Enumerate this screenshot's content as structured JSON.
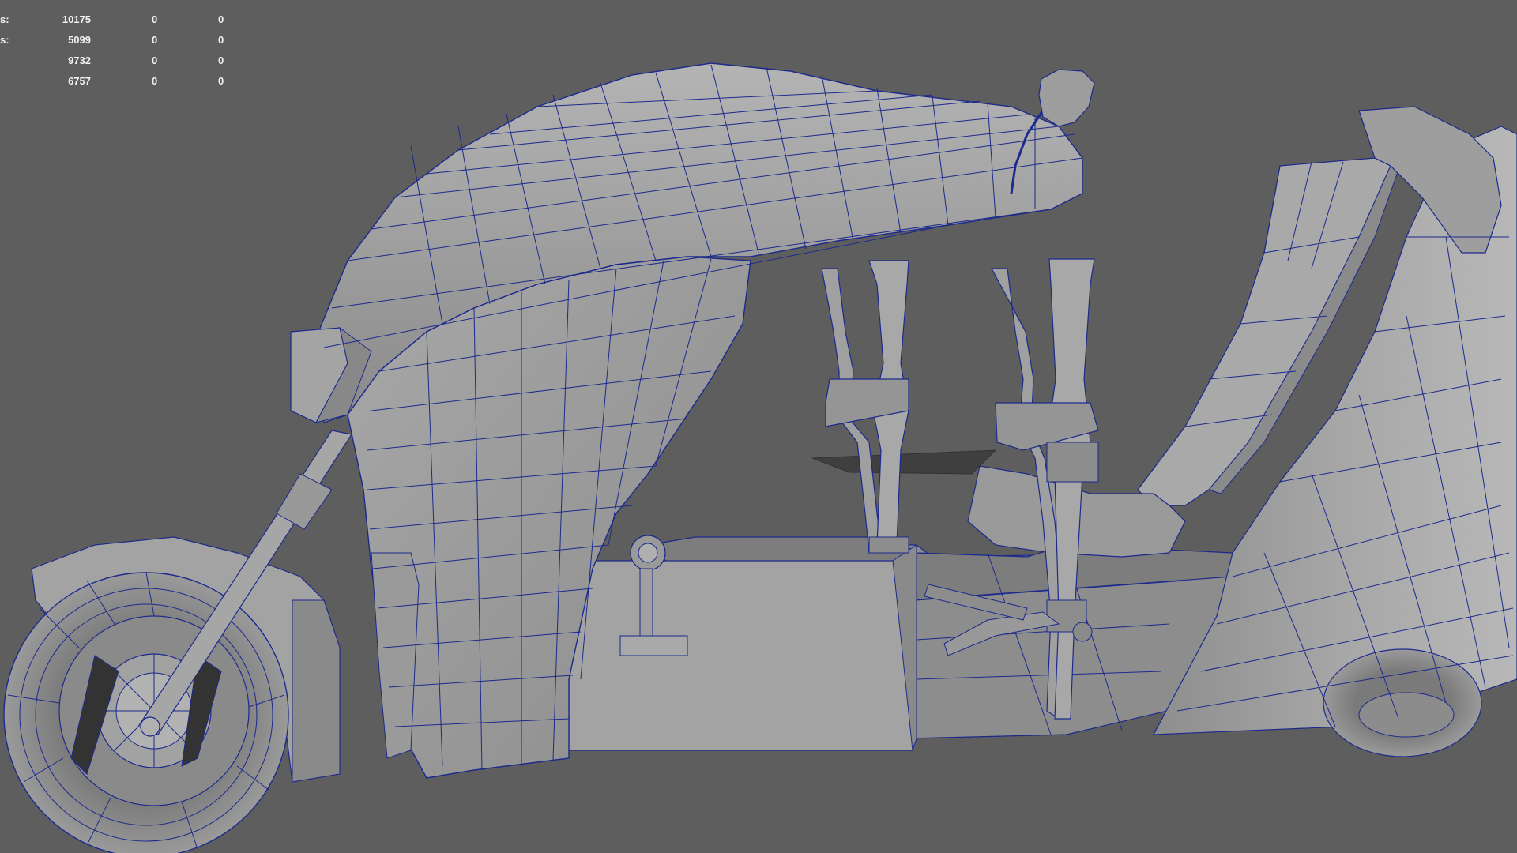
{
  "hud": {
    "rows": [
      {
        "label": "s:",
        "values": [
          "10175",
          "0",
          "0"
        ]
      },
      {
        "label": "s:",
        "values": [
          "5099",
          "0",
          "0"
        ]
      },
      {
        "label": "",
        "values": [
          "9732",
          "0",
          "0"
        ]
      },
      {
        "label": "",
        "values": [
          "6757",
          "0",
          "0"
        ]
      }
    ]
  },
  "viewport": {
    "background_color": "#5e5e5e",
    "wire_color": "#1c2a8c",
    "surface_color": "#9d9d9d",
    "model": "motorcycle-wireframe"
  }
}
